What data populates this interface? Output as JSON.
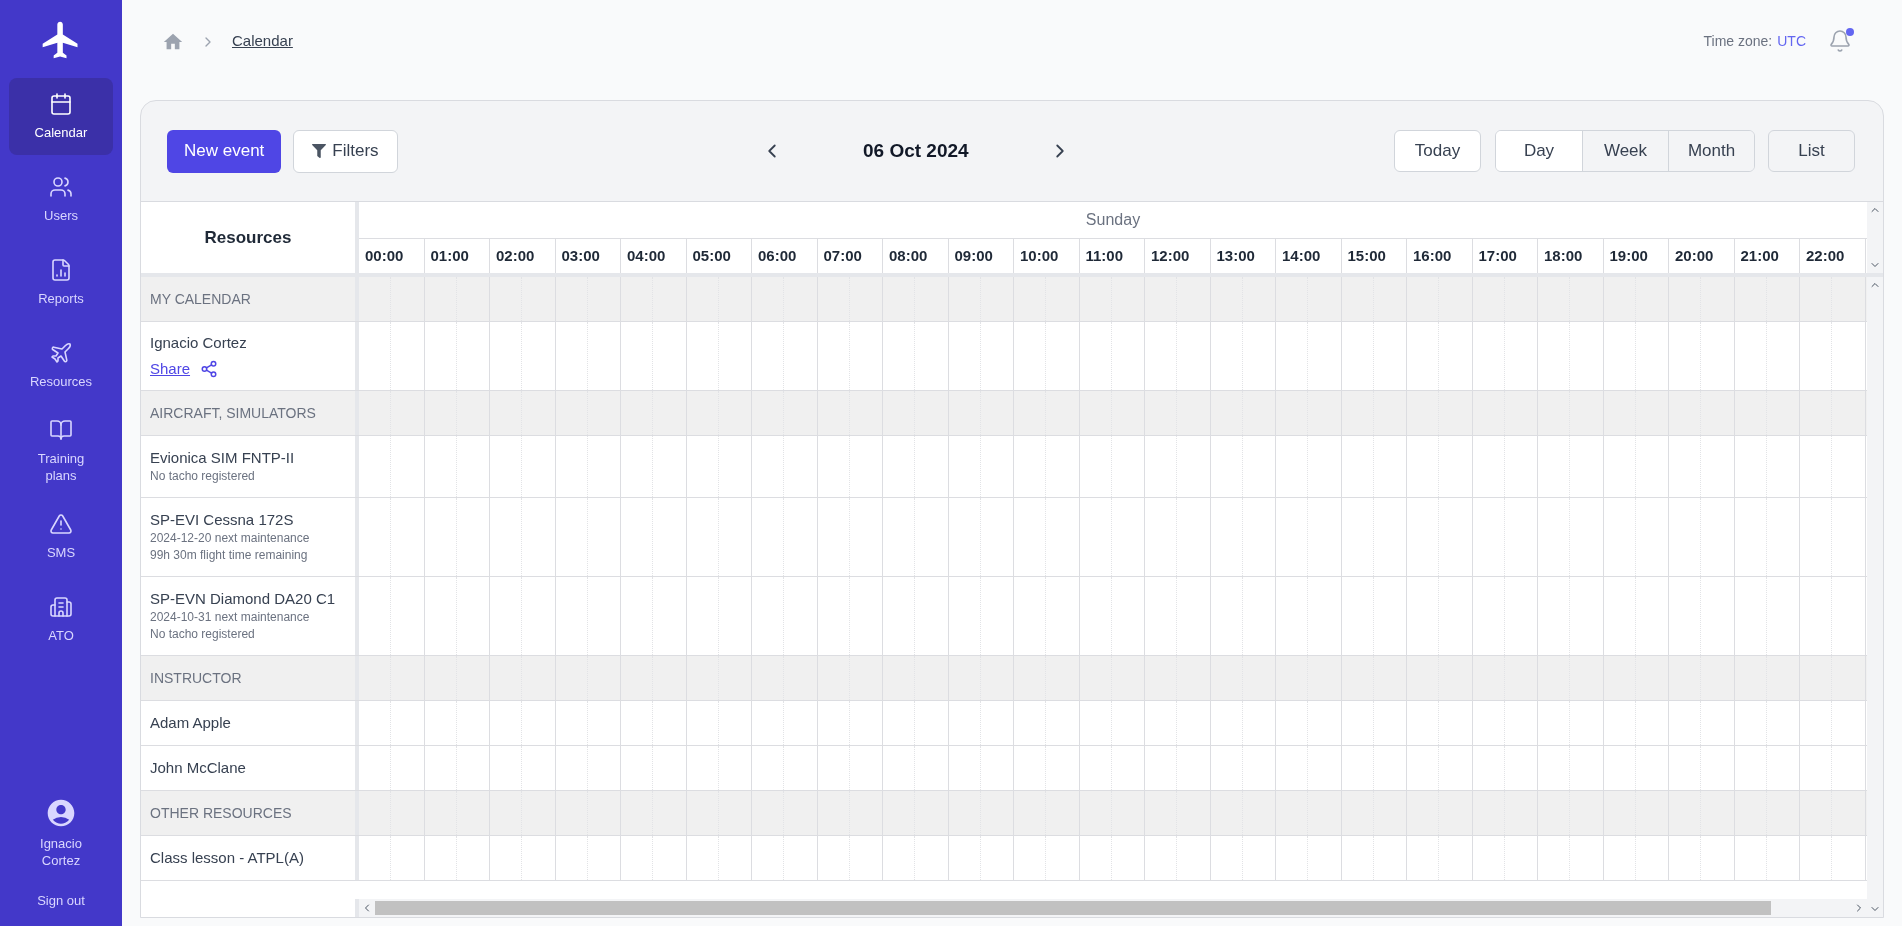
{
  "sidebar": {
    "items": [
      {
        "label": "Calendar",
        "selected": true
      },
      {
        "label": "Users",
        "selected": false
      },
      {
        "label": "Reports",
        "selected": false
      },
      {
        "label": "Resources",
        "selected": false
      },
      {
        "label": "Training plans",
        "selected": false
      },
      {
        "label": "SMS",
        "selected": false
      },
      {
        "label": "ATO",
        "selected": false
      }
    ],
    "user": {
      "name": "Ignacio Cortez"
    },
    "sign_out": "Sign out"
  },
  "breadcrumb": {
    "current": "Calendar"
  },
  "timezone": {
    "label": "Time zone:",
    "value": "UTC"
  },
  "notifications": {
    "unread": true
  },
  "toolbar": {
    "new_event": "New event",
    "filters": "Filters",
    "date": "06 Oct 2024",
    "today": "Today",
    "views": [
      {
        "label": "Day",
        "selected": true
      },
      {
        "label": "Week",
        "selected": false
      },
      {
        "label": "Month",
        "selected": false
      }
    ],
    "list": "List"
  },
  "calendar": {
    "resources_heading": "Resources",
    "day": "Sunday",
    "hours": [
      "00:00",
      "01:00",
      "02:00",
      "03:00",
      "04:00",
      "05:00",
      "06:00",
      "07:00",
      "08:00",
      "09:00",
      "10:00",
      "11:00",
      "12:00",
      "13:00",
      "14:00",
      "15:00",
      "16:00",
      "17:00",
      "18:00",
      "19:00",
      "20:00",
      "21:00",
      "22:00"
    ],
    "rows": [
      {
        "kind": "group",
        "label": "MY CALENDAR"
      },
      {
        "kind": "person",
        "name": "Ignacio Cortez",
        "share": "Share"
      },
      {
        "kind": "group",
        "label": "AIRCRAFT, SIMULATORS"
      },
      {
        "kind": "resource",
        "name": "Evionica SIM FNTP-II",
        "details": [
          "No tacho registered"
        ]
      },
      {
        "kind": "resource",
        "name": "SP-EVI Cessna 172S",
        "details": [
          "2024-12-20 next maintenance",
          "99h 30m flight time remaining"
        ]
      },
      {
        "kind": "resource",
        "name": "SP-EVN Diamond DA20 C1",
        "details": [
          "2024-10-31 next maintenance",
          "No tacho registered"
        ]
      },
      {
        "kind": "group",
        "label": "INSTRUCTOR"
      },
      {
        "kind": "resource",
        "name": "Adam Apple",
        "details": []
      },
      {
        "kind": "resource",
        "name": "John McClane",
        "details": []
      },
      {
        "kind": "group",
        "label": "OTHER RESOURCES"
      },
      {
        "kind": "resource",
        "name": "Class lesson - ATPL(A)",
        "details": []
      }
    ]
  }
}
